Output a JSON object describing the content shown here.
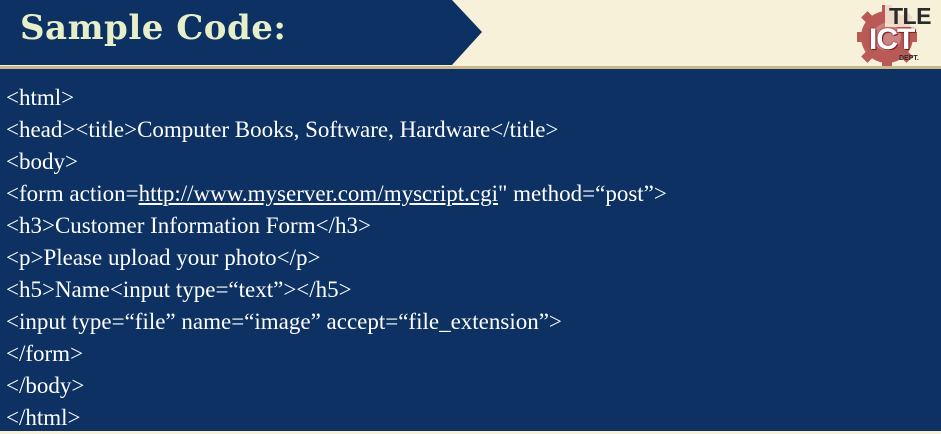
{
  "slide": {
    "title": "Sample Code:",
    "colors": {
      "header_background": "#f7f1d9",
      "banner": "#0c3162",
      "title_text": "#e6efc8",
      "code_background": "#0c3162",
      "code_text": "#ffffff"
    }
  },
  "logo": {
    "top_text": "TLE",
    "main_text": "ICT",
    "sub_text": "DEPT."
  },
  "code": {
    "lines": [
      "<html>",
      "<head><title>Computer Books, Software, Hardware</title>",
      "<body>",
      "<form action=",
      "<h3>Customer Information Form</h3>",
      "<p>Please upload your photo</p>",
      "<h5>Name<input type=“text”></h5>",
      "<input type=“file” name=“image” accept=“file_extension”>",
      "</form>",
      "</body>",
      "</html>"
    ],
    "form_link": "http://www.myserver.com/myscript.cgi",
    "form_suffix": "\" method=“post”>"
  }
}
